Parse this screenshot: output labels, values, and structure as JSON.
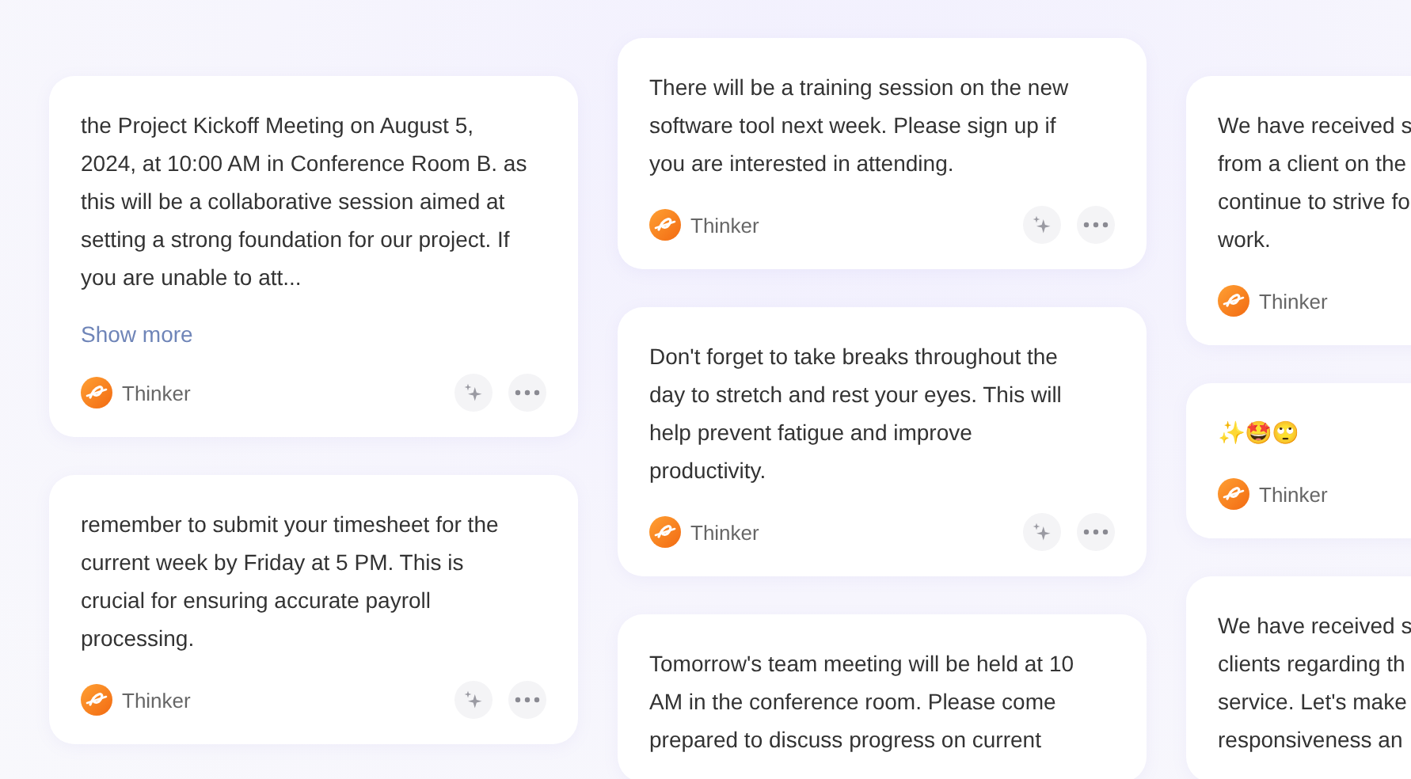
{
  "columns": [
    {
      "cards": [
        {
          "lines": [
            "the Project Kickoff Meeting on August 5,",
            "2024, at 10:00 AM in Conference Room B. as",
            "this will be a collaborative session aimed at",
            "setting a strong foundation for our project. If",
            "you are unable to att..."
          ],
          "show_more": "Show more",
          "author": "Thinker",
          "actions": [
            {
              "kind": "sparkle"
            },
            {
              "kind": "more"
            }
          ]
        },
        {
          "lines": [
            "remember to submit your timesheet for the",
            "current week by Friday at 5 PM. This is",
            "crucial for ensuring accurate payroll",
            "processing."
          ],
          "author": "Thinker",
          "actions": [
            {
              "kind": "sparkle"
            },
            {
              "kind": "more"
            }
          ]
        }
      ]
    },
    {
      "cards": [
        {
          "lines": [
            "There will be a training session on the new",
            "software tool next week. Please sign up if",
            "you are interested in attending."
          ],
          "author": "Thinker",
          "actions": [
            {
              "kind": "sparkle"
            },
            {
              "kind": "more"
            }
          ]
        },
        {
          "lines": [
            "Don't forget to take breaks throughout the",
            "day to stretch and rest your eyes. This will",
            "help prevent fatigue and improve",
            "productivity."
          ],
          "author": "Thinker",
          "actions": [
            {
              "kind": "sparkle"
            },
            {
              "kind": "more"
            }
          ]
        },
        {
          "lines": [
            "Tomorrow's team meeting will be held at 10",
            "AM in the conference room. Please come",
            "prepared to discuss progress on current"
          ]
        }
      ]
    },
    {
      "cards": [
        {
          "lines": [
            "We have received s",
            "from a client on the",
            "continue to strive fo",
            "work."
          ],
          "author": "Thinker"
        },
        {
          "lines": [
            "✨🤩🙄"
          ],
          "author": "Thinker"
        },
        {
          "lines": [
            "We have received s",
            "clients regarding th",
            "service. Let's make",
            "responsiveness an"
          ]
        }
      ]
    }
  ]
}
